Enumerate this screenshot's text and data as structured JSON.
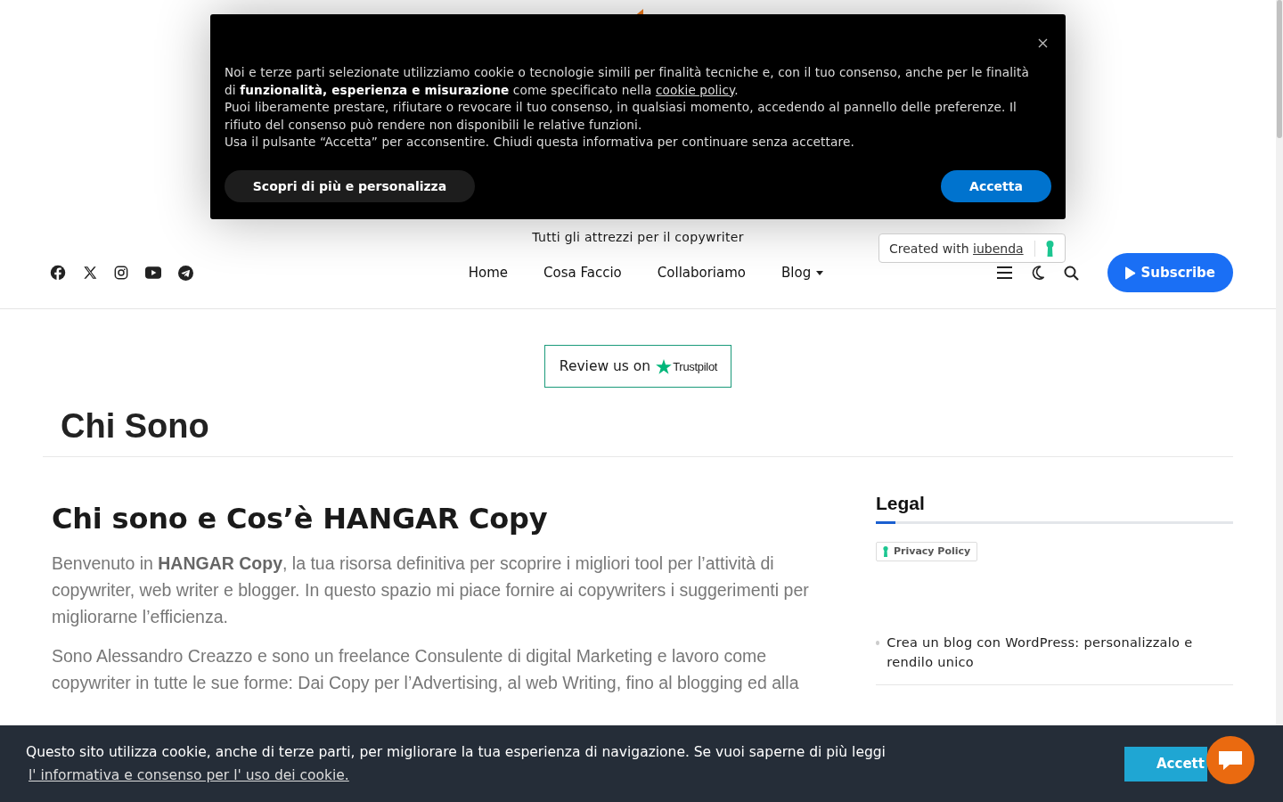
{
  "consent_dialog": {
    "paragraph_1": {
      "text": "Noi e terze parti selezionate utilizziamo cookie o tecnologie simili per finalità tecniche e, con il tuo consenso, anche per le finalità di **funzionalità, esperienza e misurazione** come specificato nella",
      "link": "cookie policy",
      "end": "."
    },
    "paragraph_2": "Puoi liberamente prestare, rifiutare o revocare il tuo consenso, in qualsiasi momento, accedendo al pannello delle preferenze. Il rifiuto del consenso può rendere non disponibili le relative funzioni.",
    "paragraph_3": "Usa il pulsante “Accetta” per acconsentire. Chiudi questa informativa per continuare senza accettare.",
    "buttons": [
      {
        "label": "Scopri di più e personalizza",
        "kind": "secondary"
      },
      {
        "label": "Accetta",
        "kind": "primary"
      }
    ]
  },
  "tagline": "Tutti gli attrezzi per il copywriter",
  "iubenda_badge": {
    "text": "Created with",
    "link": "iubenda"
  },
  "social_links": [
    {
      "kind": "facebook"
    },
    {
      "kind": "x"
    },
    {
      "kind": "instagram"
    },
    {
      "kind": "youtube"
    },
    {
      "kind": "telegram"
    }
  ],
  "nav": [
    {
      "label": "Home",
      "has_dropdown": false
    },
    {
      "label": "Cosa Faccio",
      "has_dropdown": false
    },
    {
      "label": "Collaboriamo",
      "has_dropdown": false
    },
    {
      "label": "Blog",
      "has_dropdown": true
    }
  ],
  "subscribe_button": "Subscribe",
  "trustpilot": {
    "text": "Review us on",
    "brand": "Trustpilot"
  },
  "page_title": "Chi Sono",
  "article": {
    "heading": "Chi sono e Cos’è HANGAR Copy",
    "paragraphs": [
      "Benvenuto in **HANGAR Copy**, la tua risorsa definitiva per scoprire i migliori tool per l’attività di copywriter, web writer e blogger. In questo spazio mi piace fornire ai copywriters i suggerimenti per migliorarne l’efficienza.",
      "Sono Alessandro Creazzo e sono un freelance Consulente di digital Marketing e lavoro come copywriter in tutte le sue forme: Dai Copy per l’Advertising, al web Writing, fino al blogging ed alla"
    ]
  },
  "sidebar": {
    "title": "Legal",
    "privacy_badge": "Privacy Policy",
    "posts": [
      "Crea un blog con WordPress: personalizzalo e rendilo unico"
    ]
  },
  "cookie_bar": {
    "text": "Questo sito utilizza cookie, anche di terze parti, per migliorare la tua esperienza di navigazione. Se vuoi saperne di più leggi",
    "link": "l' informativa e consenso per l' uso dei cookie.",
    "button": "Accett"
  }
}
